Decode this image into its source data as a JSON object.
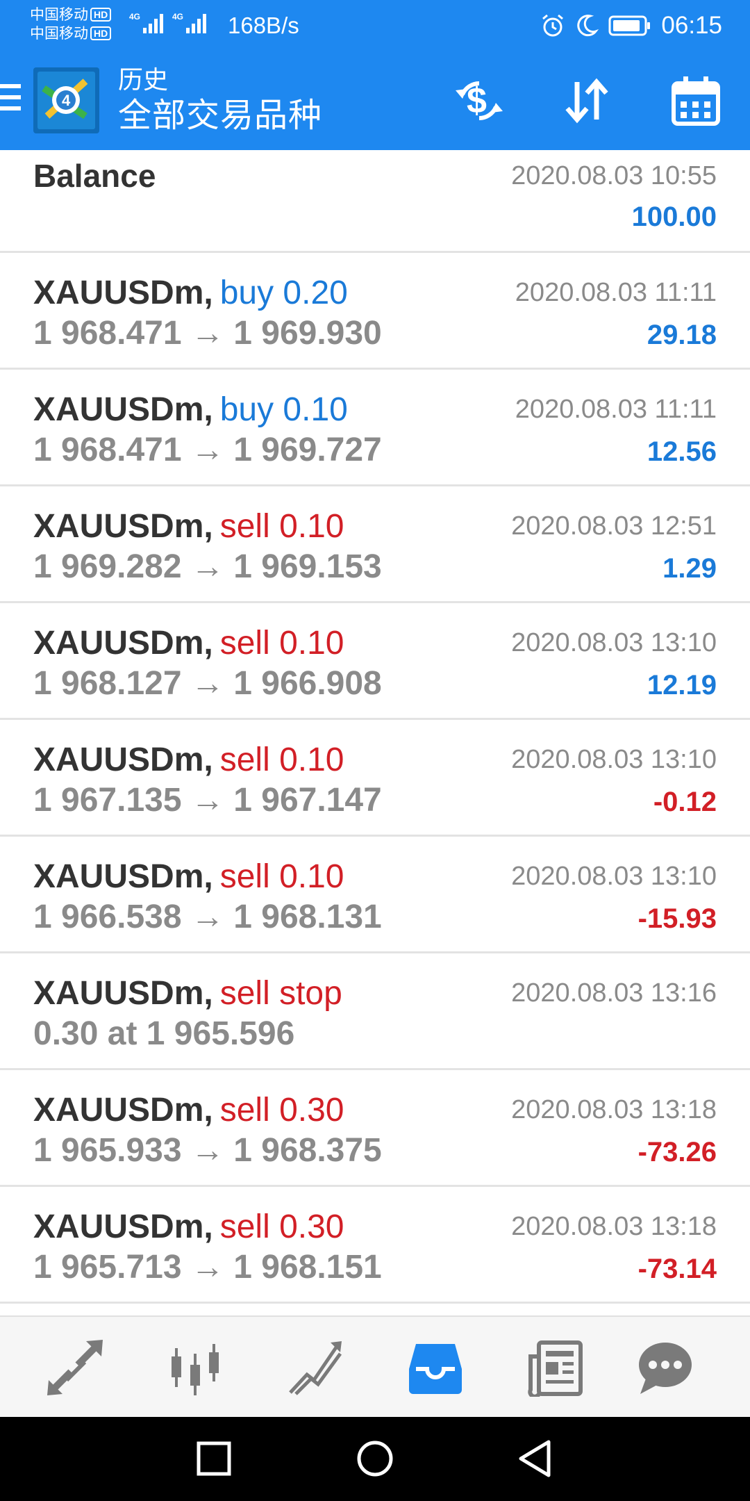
{
  "status_bar": {
    "carrier_1": "中国移动",
    "carrier_2": "中国移动",
    "hd": "HD",
    "net_type": "4G",
    "net_speed": "168B/s",
    "time": "06:15"
  },
  "app_bar": {
    "subtitle": "历史",
    "title": "全部交易品种",
    "icons": [
      "menu-icon",
      "app-logo",
      "deposit-icon",
      "sort-icon",
      "calendar-icon"
    ]
  },
  "colors": {
    "primary": "#1e88f0",
    "buy": "#1a7ad8",
    "sell": "#d21f26",
    "muted": "#8a8a8a"
  },
  "balance": {
    "label": "Balance",
    "time": "2020.08.03 10:55",
    "amount": "100.00"
  },
  "trades": [
    {
      "symbol": "XAUUSDm,",
      "side": "buy 0.20",
      "side_color": "blue",
      "detail": "1 968.471 → 1 969.930",
      "time": "2020.08.03 11:11",
      "profit": "29.18",
      "profit_color": "blue"
    },
    {
      "symbol": "XAUUSDm,",
      "side": "buy 0.10",
      "side_color": "blue",
      "detail": "1 968.471 → 1 969.727",
      "time": "2020.08.03 11:11",
      "profit": "12.56",
      "profit_color": "blue"
    },
    {
      "symbol": "XAUUSDm,",
      "side": "sell 0.10",
      "side_color": "red",
      "detail": "1 969.282 → 1 969.153",
      "time": "2020.08.03 12:51",
      "profit": "1.29",
      "profit_color": "blue"
    },
    {
      "symbol": "XAUUSDm,",
      "side": "sell 0.10",
      "side_color": "red",
      "detail": "1 968.127 → 1 966.908",
      "time": "2020.08.03 13:10",
      "profit": "12.19",
      "profit_color": "blue"
    },
    {
      "symbol": "XAUUSDm,",
      "side": "sell 0.10",
      "side_color": "red",
      "detail": "1 967.135 → 1 967.147",
      "time": "2020.08.03 13:10",
      "profit": "-0.12",
      "profit_color": "red"
    },
    {
      "symbol": "XAUUSDm,",
      "side": "sell 0.10",
      "side_color": "red",
      "detail": "1 966.538 → 1 968.131",
      "time": "2020.08.03 13:10",
      "profit": "-15.93",
      "profit_color": "red"
    },
    {
      "symbol": "XAUUSDm,",
      "side": "sell stop",
      "side_color": "red",
      "detail": "0.30 at 1 965.596",
      "time": "2020.08.03 13:16",
      "profit": "",
      "profit_color": "blue"
    },
    {
      "symbol": "XAUUSDm,",
      "side": "sell 0.30",
      "side_color": "red",
      "detail": "1 965.933 → 1 968.375",
      "time": "2020.08.03 13:18",
      "profit": "-73.26",
      "profit_color": "red"
    },
    {
      "symbol": "XAUUSDm,",
      "side": "sell 0.30",
      "side_color": "red",
      "detail": "1 965.713 → 1 968.151",
      "time": "2020.08.03 13:18",
      "profit": "-73.14",
      "profit_color": "red"
    }
  ],
  "bottom_nav": {
    "items": [
      "quotes-icon",
      "chart-icon",
      "trade-icon",
      "history-icon",
      "news-icon",
      "chat-icon"
    ],
    "active": "history-icon"
  },
  "system_nav": [
    "recents-icon",
    "home-icon",
    "back-icon"
  ]
}
